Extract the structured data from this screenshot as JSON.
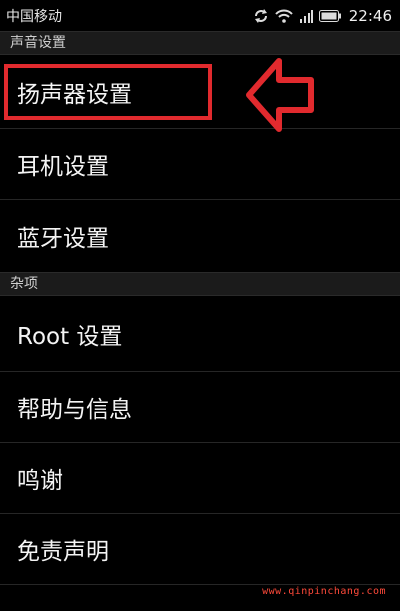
{
  "status_bar": {
    "carrier": "中国移动",
    "time": "22:46",
    "icons": [
      "sync-icon",
      "wifi-icon",
      "signal-icon",
      "battery-icon"
    ]
  },
  "sections": [
    {
      "header": "声音设置",
      "items": [
        "扬声器设置",
        "耳机设置",
        "蓝牙设置"
      ]
    },
    {
      "header": "杂项",
      "items": [
        "Root 设置",
        "帮助与信息",
        "鸣谢",
        "免责声明"
      ]
    }
  ],
  "annotation": {
    "highlight_color": "#e12a2e",
    "highlighted_item": "扬声器设置"
  },
  "watermark": "www.qinpinchang.com"
}
